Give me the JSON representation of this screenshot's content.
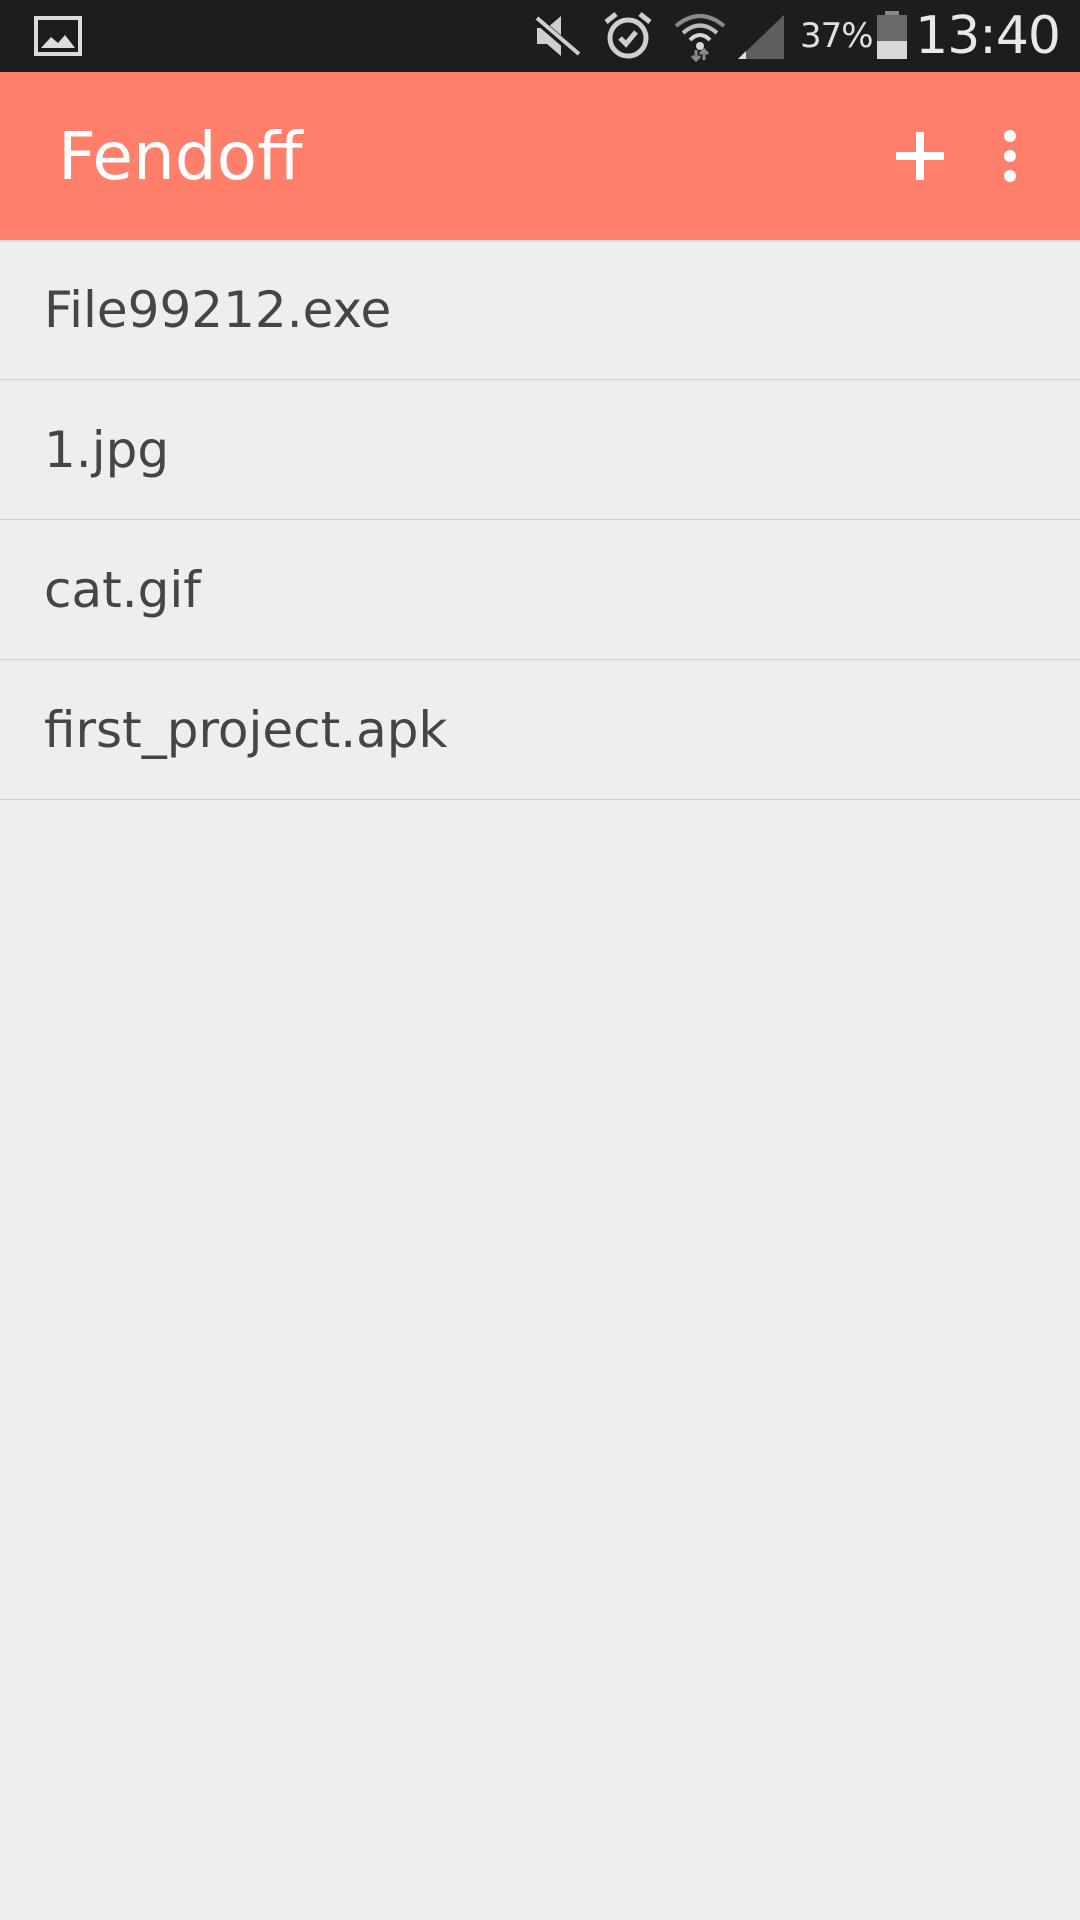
{
  "status_bar": {
    "icons": [
      "gallery-icon",
      "mute-icon",
      "alarm-icon",
      "wifi-icon",
      "signal-icon",
      "battery-icon"
    ],
    "battery_percent": "37%",
    "time": "13:40"
  },
  "app_bar": {
    "title": "Fendoff",
    "actions": [
      "add-icon",
      "overflow-menu-icon"
    ],
    "background_color": "#ff7f6b"
  },
  "files": [
    {
      "name": "File99212.exe"
    },
    {
      "name": "1.jpg"
    },
    {
      "name": "cat.gif"
    },
    {
      "name": "first_project.apk"
    }
  ],
  "colors": {
    "status_bar": "#1c1d1d",
    "background": "#eeeeef",
    "text": "#454545",
    "divider": "#d0d0d0"
  }
}
